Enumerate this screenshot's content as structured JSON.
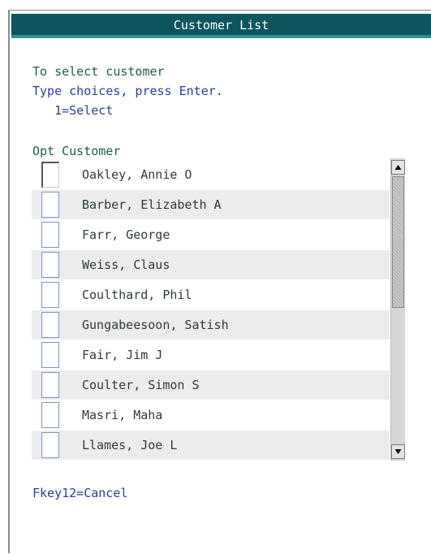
{
  "window": {
    "title": "Customer List"
  },
  "instructions": {
    "heading": "To select customer",
    "line1": "Type choices, press Enter.",
    "line2": "   1=Select"
  },
  "list": {
    "header": "Opt Customer",
    "rows": [
      {
        "opt": "",
        "name": "Oakley, Annie O"
      },
      {
        "opt": "",
        "name": "Barber, Elizabeth A"
      },
      {
        "opt": "",
        "name": "Farr, George"
      },
      {
        "opt": "",
        "name": "Weiss, Claus"
      },
      {
        "opt": "",
        "name": "Coulthard, Phil"
      },
      {
        "opt": "",
        "name": "Gungabeesoon, Satish"
      },
      {
        "opt": "",
        "name": "Fair, Jim J"
      },
      {
        "opt": "",
        "name": "Coulter, Simon S"
      },
      {
        "opt": "",
        "name": "Masri, Maha"
      },
      {
        "opt": "",
        "name": "Llames, Joe L"
      }
    ]
  },
  "footer": {
    "fkeys": "Fkey12=Cancel"
  },
  "colors": {
    "titlebar": "#0d545e",
    "accent": "#2f8f95",
    "prompt_text": "#2c3e9e",
    "heading_text": "#1f5f3f"
  }
}
